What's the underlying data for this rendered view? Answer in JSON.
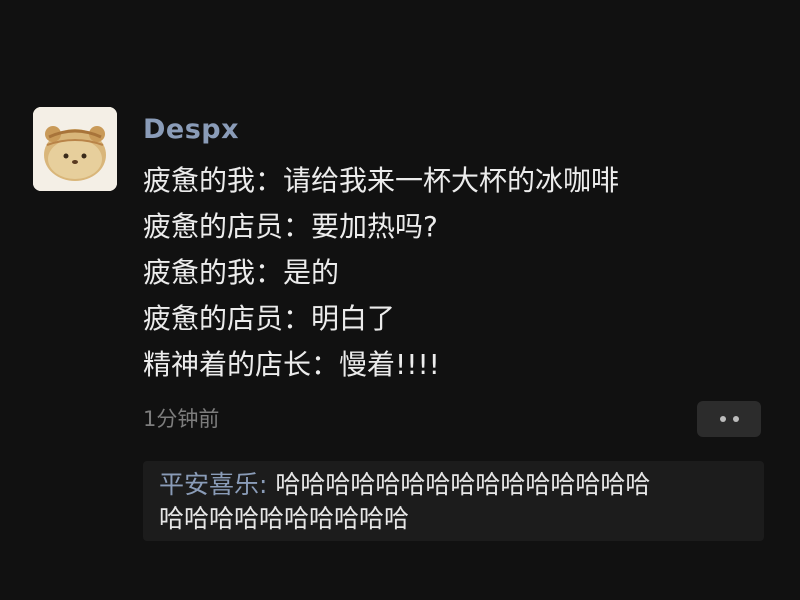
{
  "post": {
    "username": "Despx",
    "lines": [
      "疲惫的我：请给我来一杯大杯的冰咖啡",
      "疲惫的店员：要加热吗?",
      "疲惫的我：是的",
      "疲惫的店员：明白了",
      "精神着的店长：慢着!!!!"
    ],
    "timestamp": "1分钟前",
    "more_icon": "ellipsis-icon"
  },
  "comment": {
    "author": "平安喜乐",
    "separator": ": ",
    "text_line1": "哈哈哈哈哈哈哈哈哈哈哈哈哈哈哈",
    "text_line2": "哈哈哈哈哈哈哈哈哈哈"
  },
  "colors": {
    "background": "#111111",
    "username": "#8a9cb8",
    "text": "#ececec",
    "timestamp": "#7d7d7d"
  }
}
